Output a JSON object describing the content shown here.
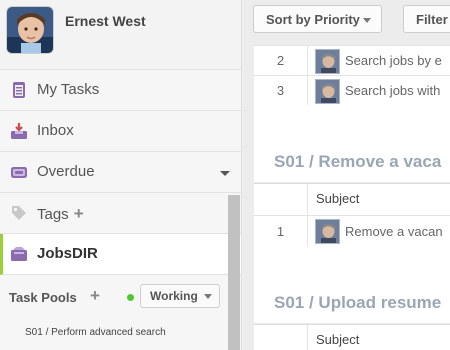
{
  "profile": {
    "name": "Ernest West"
  },
  "nav": [
    {
      "label": "My Tasks",
      "icon": "clipboard-icon"
    },
    {
      "label": "Inbox",
      "icon": "inbox-icon"
    },
    {
      "label": "Overdue",
      "icon": "overdue-icon"
    },
    {
      "label": "Tags",
      "icon": "tag-icon"
    },
    {
      "label": "JobsDIR",
      "icon": "folder-icon"
    }
  ],
  "pools": {
    "label": "Task Pools",
    "status": "Working",
    "status_color": "#4ccb2b",
    "items": [
      "S01 / Perform advanced search"
    ]
  },
  "toolbar": {
    "sort_label": "Sort by Priority",
    "filter_label": "Filter"
  },
  "sections": [
    {
      "rows": [
        {
          "num": "2",
          "subject": "Search jobs by e"
        },
        {
          "num": "3",
          "subject": "Search jobs with"
        }
      ]
    },
    {
      "title": "S01 / Remove a vaca",
      "header": "Subject",
      "rows": [
        {
          "num": "1",
          "subject": "Remove a vacan"
        }
      ]
    },
    {
      "title": "S01 / Upload resume",
      "header": "Subject"
    }
  ],
  "colors": {
    "accent": "#9ccf3a",
    "section_title": "#9aa6b4"
  }
}
